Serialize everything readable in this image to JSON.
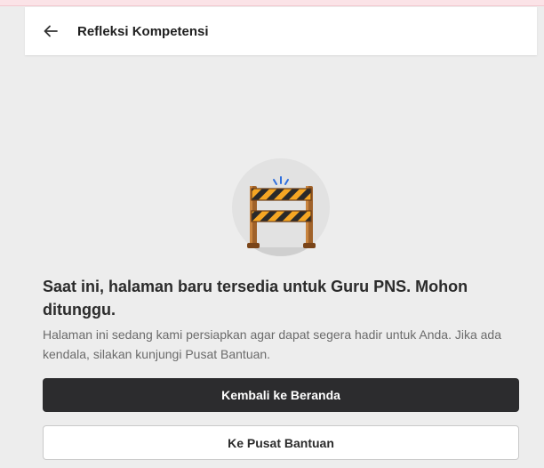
{
  "header": {
    "title": "Refleksi Kompetensi",
    "back_icon": "arrow-left-icon"
  },
  "illustration": {
    "icon": "construction-barrier-icon"
  },
  "message": {
    "title": "Saat ini, halaman baru tersedia untuk Guru PNS. Mohon ditunggu.",
    "description": "Halaman ini sedang kami persiapkan agar dapat segera hadir untuk Anda. Jika ada kendala, silakan kunjungi Pusat Bantuan."
  },
  "actions": {
    "primary_label": "Kembali ke Beranda",
    "secondary_label": "Ke Pusat Bantuan"
  },
  "colors": {
    "background": "#ededed",
    "primary_button": "#2c2c2e",
    "barrier_stripe": "#f5a623",
    "barrier_wood": "#a0622a",
    "spark_blue": "#2f6fde"
  }
}
